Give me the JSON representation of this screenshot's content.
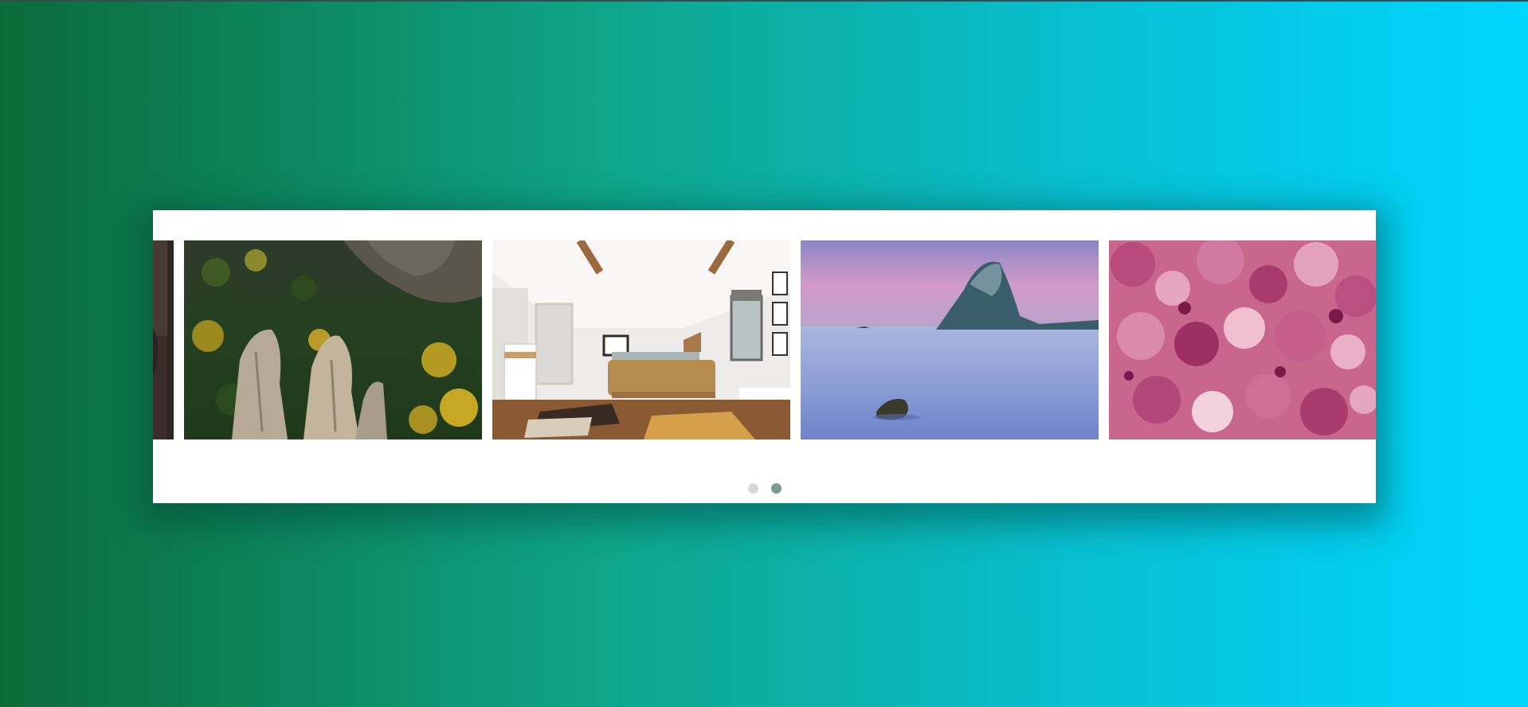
{
  "carousel": {
    "slides": [
      {
        "subject": "partial-dark-image",
        "icon": "photo"
      },
      {
        "subject": "aerial-forest-rocks",
        "icon": "photo"
      },
      {
        "subject": "attic-bedroom",
        "icon": "photo"
      },
      {
        "subject": "sea-island-dusk",
        "icon": "photo"
      },
      {
        "subject": "pink-abstract-texture",
        "icon": "photo"
      }
    ],
    "pagination": {
      "pages": 2,
      "active_index": 1
    }
  },
  "colors": {
    "background_gradient": [
      "#0b6b38",
      "#0ea68a",
      "#08bfd0",
      "#00d6ff"
    ],
    "card": "#ffffff",
    "dot_inactive": "#d7d7d7",
    "dot_active": "#7f9691"
  }
}
